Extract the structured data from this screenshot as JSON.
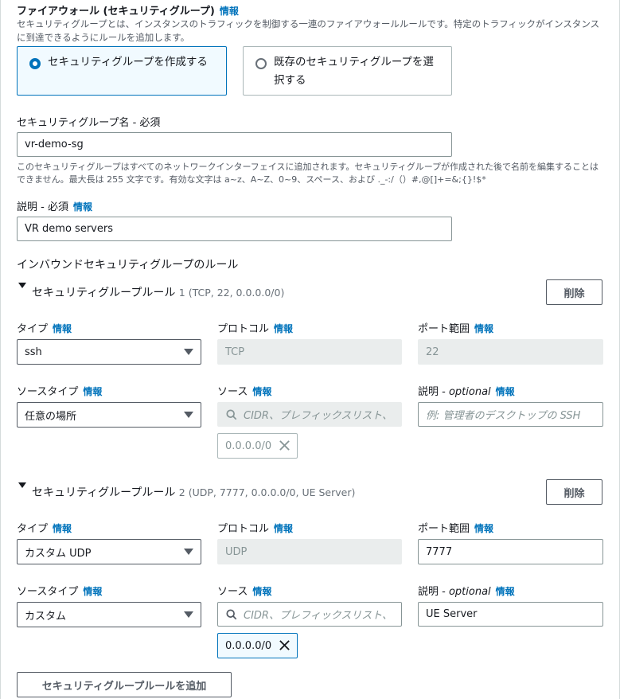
{
  "firewall": {
    "title": "ファイアウォール (セキュリティグループ)",
    "info": "情報",
    "description": "セキュリティグループとは、インスタンスのトラフィックを制御する一連のファイアウォールルールです。特定のトラフィックがインスタンスに到達できるようにルールを追加します。",
    "options": [
      {
        "label": "セキュリティグループを作成する",
        "selected": true
      },
      {
        "label": "既存のセキュリティグループを選択する",
        "selected": false
      }
    ]
  },
  "sg_name": {
    "label": "セキュリティグループ名 - 必須",
    "value": "vr-demo-sg",
    "hint": "このセキュリティグループはすべてのネットワークインターフェイスに追加されます。セキュリティグループが作成された後で名前を編集することはできません。最大長は 255 文字です。有効な文字は a~z、A~Z、0~9、スペース、および ._-:/（）#,@[]+=&;{}!$*"
  },
  "sg_desc": {
    "label": "説明 - 必須",
    "info": "情報",
    "value": "VR demo servers"
  },
  "inbound": {
    "title": "インバウンドセキュリティグループのルール",
    "field_labels": {
      "type": "タイプ",
      "protocol": "プロトコル",
      "port_range": "ポート範囲",
      "source_type": "ソースタイプ",
      "source": "ソース",
      "desc_prefix": "説明 - ",
      "desc_optional": "optional",
      "info": "情報"
    },
    "delete_label": "削除",
    "source_placeholder": "CIDR、プレフィックスリスト、",
    "rules": [
      {
        "heading": "セキュリティグループルール",
        "summary": "1 (TCP, 22, 0.0.0.0/0)",
        "type": "ssh",
        "protocol": "TCP",
        "port_range": "22",
        "source_type": "任意の場所",
        "source_token": "0.0.0.0/0",
        "description_placeholder": "例: 管理者のデスクトップの SSH",
        "description_value": ""
      },
      {
        "heading": "セキュリティグループルール",
        "summary": "2 (UDP, 7777, 0.0.0.0/0, UE Server)",
        "type": "カスタム UDP",
        "protocol": "UDP",
        "port_range": "7777",
        "source_type": "カスタム",
        "source_token": "0.0.0.0/0",
        "description_placeholder": "",
        "description_value": "UE Server"
      }
    ],
    "add_rule_label": "セキュリティグループルールを追加"
  },
  "colors": {
    "accent": "#0073bb",
    "text": "#16191f",
    "muted": "#545b64",
    "disabled_bg": "#eaeded"
  }
}
